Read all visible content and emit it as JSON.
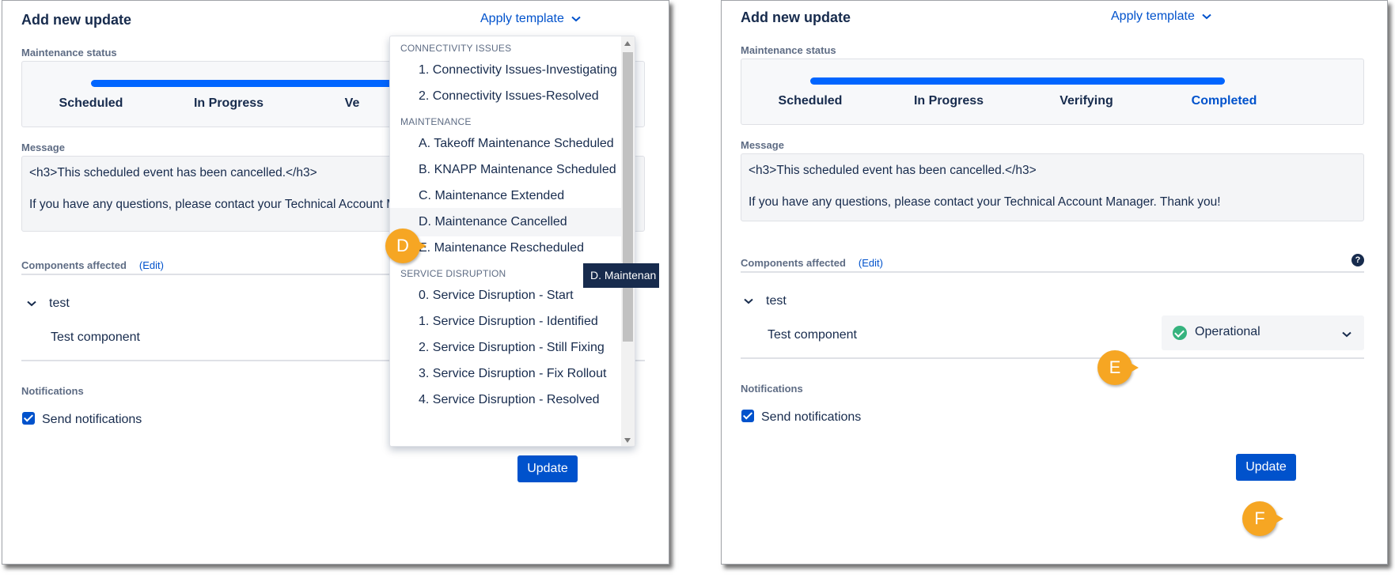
{
  "left_panel": {
    "title": "Add new update",
    "apply_template": "Apply template",
    "maintenance_status_label": "Maintenance status",
    "stages": [
      "Scheduled",
      "In Progress",
      "Ve"
    ],
    "progress": 0.67,
    "message_label": "Message",
    "message_line1": "<h3>This scheduled event has been cancelled.</h3>",
    "message_line2": "If you have any questions, please contact your Technical Account M",
    "components_label": "Components affected",
    "edit_label": "(Edit)",
    "group_name": "test",
    "component_name": "Test component",
    "notifications_label": "Notifications",
    "send_notifications": "Send notifications",
    "update_button": "Update"
  },
  "template_dropdown": {
    "groups": [
      {
        "heading": "CONNECTIVITY ISSUES",
        "items": [
          "1. Connectivity Issues-Investigating",
          "2. Connectivity Issues-Resolved"
        ]
      },
      {
        "heading": "MAINTENANCE",
        "items": [
          "A. Takeoff Maintenance Scheduled",
          "B. KNAPP Maintenance Scheduled",
          "C. Maintenance Extended",
          "D. Maintenance Cancelled",
          "E. Maintenance Rescheduled"
        ]
      },
      {
        "heading": "SERVICE DISRUPTION",
        "items": [
          "0. Service Disruption - Start",
          "1. Service Disruption - Identified",
          "2. Service Disruption - Still Fixing",
          "3. Service Disruption - Fix Rollout",
          "4. Service Disruption - Resolved"
        ]
      }
    ],
    "hovered_item": "D. Maintenance Cancelled",
    "tooltip": "D. Maintenan"
  },
  "right_panel": {
    "title": "Add new update",
    "apply_template": "Apply template",
    "maintenance_status_label": "Maintenance status",
    "stages": [
      "Scheduled",
      "In Progress",
      "Verifying",
      "Completed"
    ],
    "active_stage": "Completed",
    "progress": 1.0,
    "message_label": "Message",
    "message_line1": "<h3>This scheduled event has been cancelled.</h3>",
    "message_line2": "If you have any questions, please contact your Technical Account Manager. Thank you!",
    "components_label": "Components affected",
    "edit_label": "(Edit)",
    "help_icon": "?",
    "group_name": "test",
    "component_name": "Test component",
    "component_status": "Operational",
    "notifications_label": "Notifications",
    "send_notifications": "Send notifications",
    "update_button": "Update"
  },
  "markers": {
    "d": "D",
    "e": "E",
    "f": "F",
    "color": "#f6a623"
  },
  "colors": {
    "accent": "#0052cc",
    "progress": "#0065ff",
    "operational": "#36b37e"
  }
}
